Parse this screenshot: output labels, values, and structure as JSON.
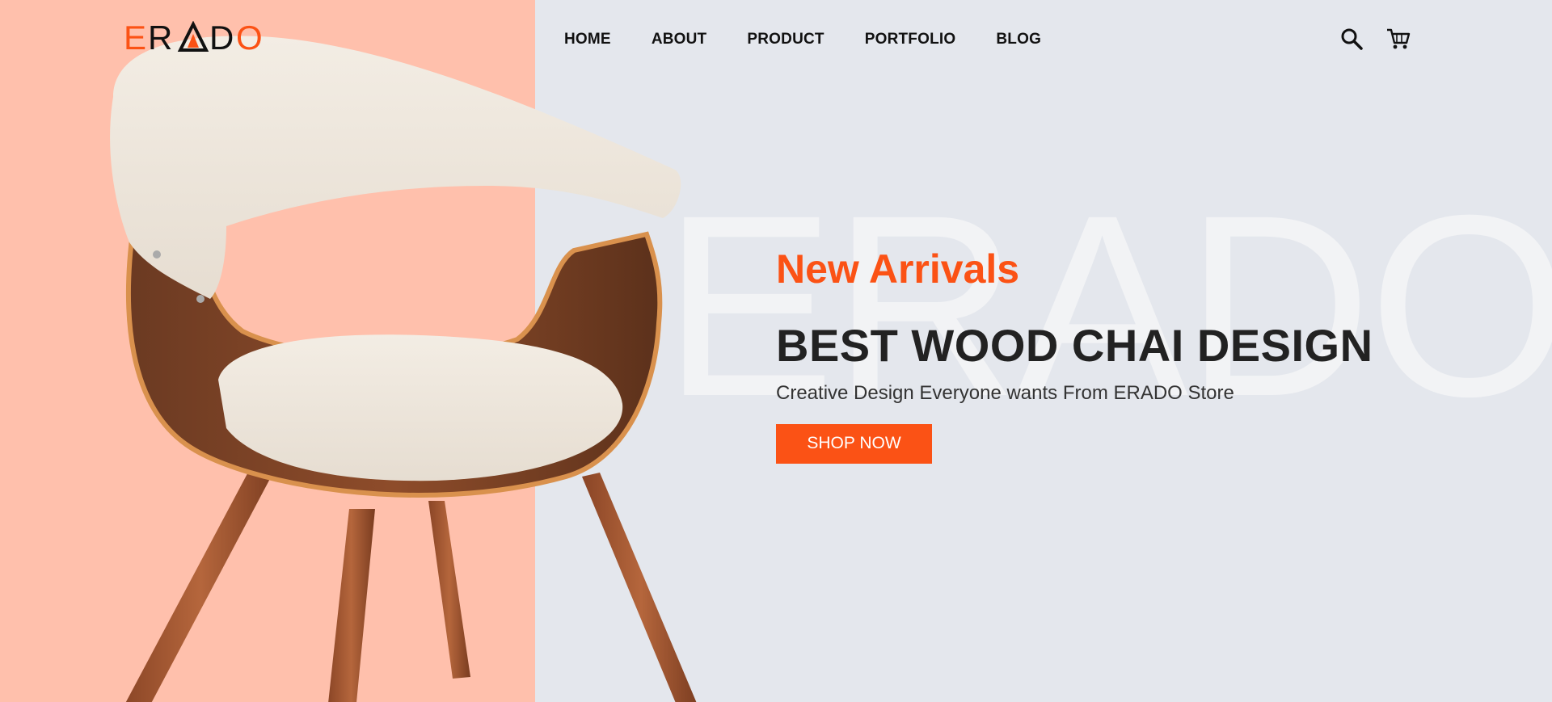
{
  "brand": {
    "name": "ERADO",
    "logo_colors": [
      "#fb5215",
      "#000000"
    ]
  },
  "nav": {
    "items": [
      {
        "label": "HOME"
      },
      {
        "label": "ABOUT"
      },
      {
        "label": "PRODUCT"
      },
      {
        "label": "PORTFOLIO"
      },
      {
        "label": "BLOG"
      }
    ]
  },
  "header_icons": [
    "search-icon",
    "cart-icon"
  ],
  "hero": {
    "watermark": "ERADO",
    "eyebrow": "New Arrivals",
    "title": "BEST WOOD CHAI DESIGN",
    "subtitle": "Creative Design Everyone wants From ERADO Store",
    "cta_label": "SHOP NOW"
  },
  "colors": {
    "accent": "#fb5215",
    "left_panel": "#ffc0ac",
    "background": "#e4e7ed",
    "text_dark": "#222222"
  }
}
